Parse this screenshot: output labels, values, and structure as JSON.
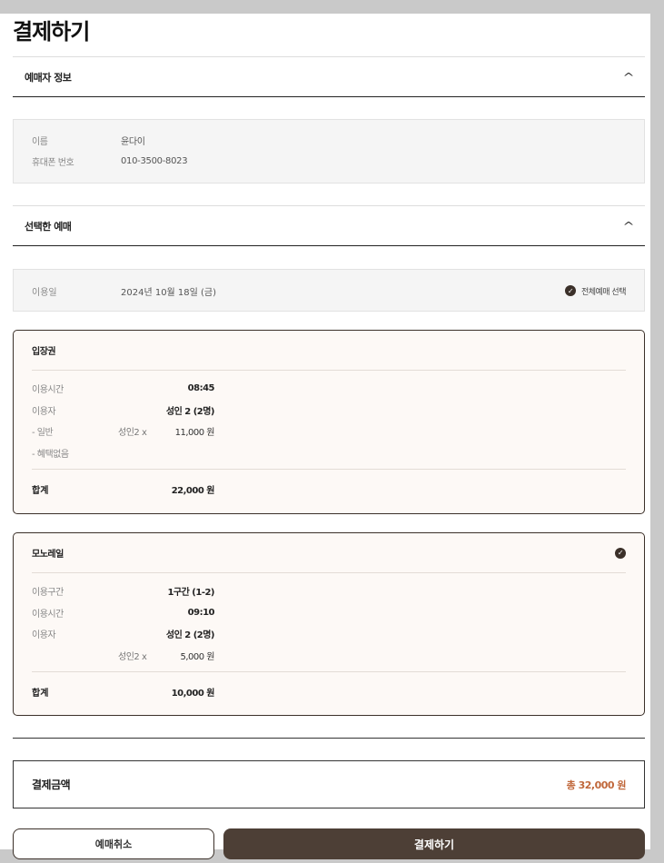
{
  "page": {
    "title": "결제하기"
  },
  "booker": {
    "header": "예매자 정보",
    "rows": [
      {
        "label": "이름",
        "value": "윤다이"
      },
      {
        "label": "휴대폰 번호",
        "value": "010-3500-8023"
      }
    ]
  },
  "selection": {
    "header": "선택한 예매",
    "date_label": "이용일",
    "date_value": "2024년 10월 18일 (금)",
    "select_all": "전체예매 선택"
  },
  "ticket": {
    "title": "입장권",
    "time_label": "이용시간",
    "time_value": "08:45",
    "person_label": "이용자",
    "person_value": "성인 2 (2명)",
    "general_label": "- 일반",
    "general_count": "성인2 x",
    "general_price": "11,000 원",
    "discount_label": "- 혜택없음",
    "total_label": "합계",
    "total_value": "22,000 원"
  },
  "monorail": {
    "title": "모노레일",
    "section_label": "이용구간",
    "section_value": "1구간 (1-2)",
    "time_label": "이용시간",
    "time_value": "09:10",
    "person_label": "이용자",
    "person_value": "성인 2 (2명)",
    "count": "성인2 x",
    "price": "5,000 원",
    "total_label": "합계",
    "total_value": "10,000 원"
  },
  "payment": {
    "label": "결제금액",
    "total": "총 32,000 원"
  },
  "buttons": {
    "cancel": "예매취소",
    "pay": "결제하기"
  },
  "colors": {
    "accent": "#4d3f36",
    "price": "#c0673a",
    "card_bg": "#fdf9f6"
  }
}
